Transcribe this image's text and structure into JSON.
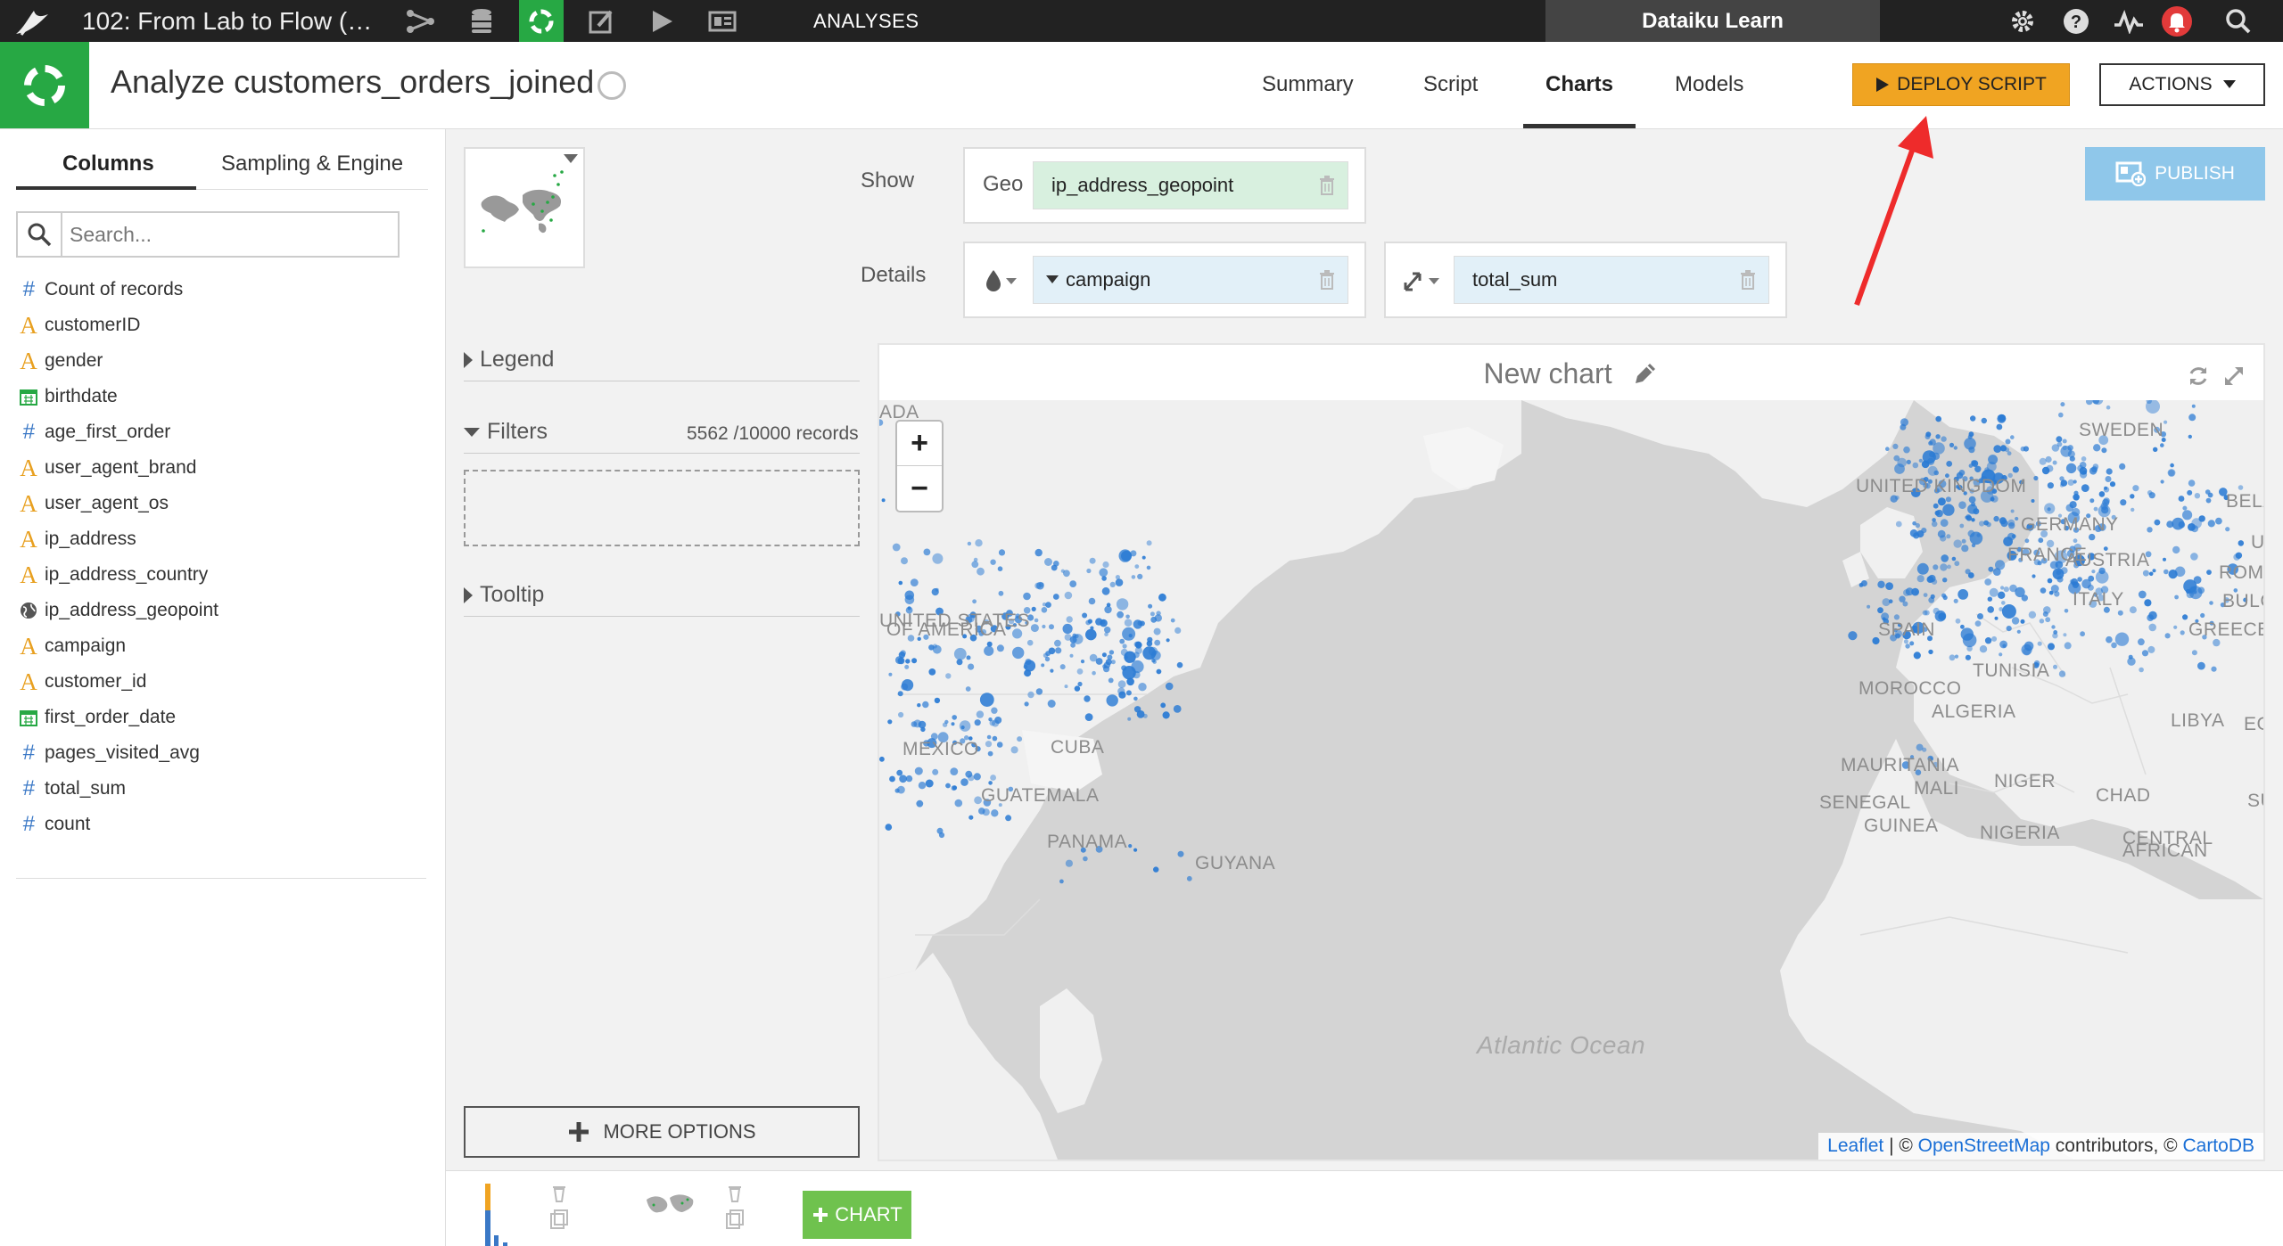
{
  "topbar": {
    "project_name": "102: From Lab to Flow (…",
    "section_label": "ANALYSES",
    "instance_name": "Dataiku Learn",
    "nav_icons": [
      "flow-icon",
      "datasets-icon",
      "analyses-icon",
      "notebooks-icon",
      "jobs-icon",
      "dashboards-icon"
    ],
    "right_icons": [
      "gear-icon",
      "help-icon",
      "activity-icon",
      "notifications-icon",
      "search-icon"
    ]
  },
  "header": {
    "title": "Analyze customers_orders_joined",
    "tabs": [
      {
        "label": "Summary",
        "active": false
      },
      {
        "label": "Script",
        "active": false
      },
      {
        "label": "Charts",
        "active": true
      },
      {
        "label": "Models",
        "active": false
      }
    ],
    "deploy_label": "DEPLOY SCRIPT",
    "actions_label": "ACTIONS",
    "deploy_color": "#f0a422",
    "accent_green": "#27a844"
  },
  "left_panel": {
    "tabs": [
      {
        "label": "Columns",
        "active": true
      },
      {
        "label": "Sampling & Engine",
        "active": false
      }
    ],
    "search_placeholder": "Search...",
    "columns": [
      {
        "name": "Count of records",
        "type": "number"
      },
      {
        "name": "customerID",
        "type": "alpha"
      },
      {
        "name": "gender",
        "type": "alpha"
      },
      {
        "name": "birthdate",
        "type": "date"
      },
      {
        "name": "age_first_order",
        "type": "number"
      },
      {
        "name": "user_agent_brand",
        "type": "alpha"
      },
      {
        "name": "user_agent_os",
        "type": "alpha"
      },
      {
        "name": "ip_address",
        "type": "alpha"
      },
      {
        "name": "ip_address_country",
        "type": "alpha"
      },
      {
        "name": "ip_address_geopoint",
        "type": "geo"
      },
      {
        "name": "campaign",
        "type": "alpha"
      },
      {
        "name": "customer_id",
        "type": "alpha"
      },
      {
        "name": "first_order_date",
        "type": "date"
      },
      {
        "name": "pages_visited_avg",
        "type": "number"
      },
      {
        "name": "total_sum",
        "type": "number"
      },
      {
        "name": "count",
        "type": "number"
      }
    ]
  },
  "config": {
    "legend_label": "Legend",
    "filters_label": "Filters",
    "filters_count": "5562 /10000 records",
    "tooltip_label": "Tooltip",
    "more_options_label": "MORE OPTIONS",
    "show_label": "Show",
    "details_label": "Details",
    "geo_label": "Geo",
    "geo_column": "ip_address_geopoint",
    "color_column": "campaign",
    "size_column": "total_sum",
    "publish_label": "PUBLISH"
  },
  "chart": {
    "title": "New chart",
    "zoom_in": "+",
    "zoom_out": "−",
    "map_labels": [
      "ADA",
      "SWEDEN",
      "UNITED KINGDOM",
      "BELA",
      "GERMANY",
      "FRANCE",
      "AUSTRIA",
      "U",
      "ROMANI",
      "ITALY",
      "BULGAR",
      "UNITED STATES",
      "OF AMERICA",
      "SPAIN",
      "GREECE",
      "TUNISIA",
      "MOROCCO",
      "ALGERIA",
      "LIBYA",
      "EG",
      "MEXICO",
      "CUBA",
      "MAURITANIA",
      "MALI",
      "NIGER",
      "CHAD",
      "SU",
      "GUATEMALA",
      "SENEGAL",
      "GUINEA",
      "NIGERIA",
      "CENTRAL",
      "AFRICAN",
      "PANAMA",
      "GUYANA"
    ],
    "ocean_label": "Atlantic Ocean",
    "attribution": {
      "leaflet": "Leaflet",
      "sep1": " | © ",
      "osm": "OpenStreetMap",
      "mid": " contributors, © ",
      "carto": "CartoDB"
    },
    "point_color": "#2b7bd4"
  },
  "bottom_bar": {
    "add_chart_label": "CHART"
  }
}
